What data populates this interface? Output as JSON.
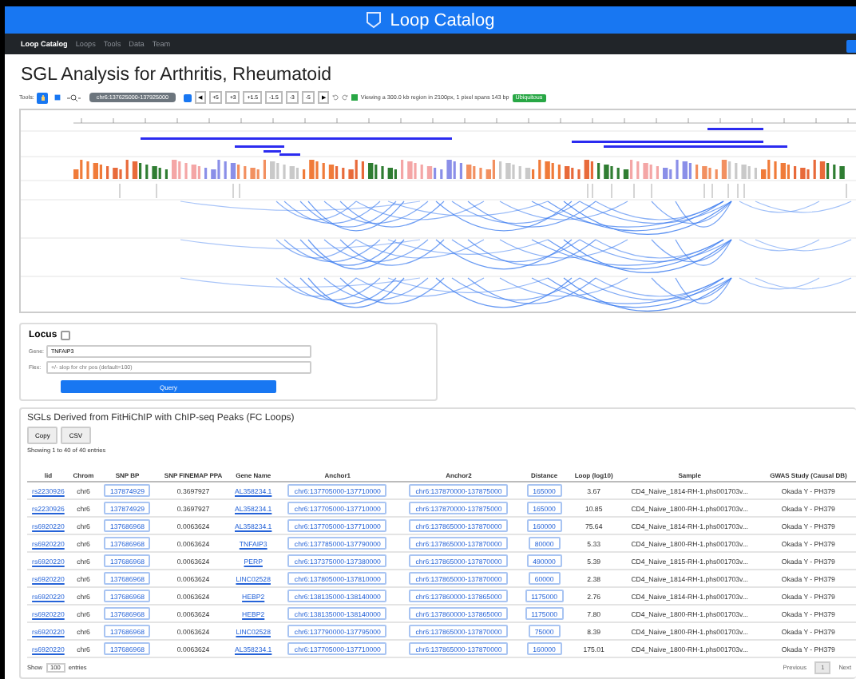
{
  "header": {
    "title": "Loop Catalog"
  },
  "nav": {
    "items": [
      {
        "label": "Loop Catalog",
        "selected": true
      },
      {
        "label": "Loops",
        "selected": false
      },
      {
        "label": "Tools",
        "selected": false
      },
      {
        "label": "Data",
        "selected": false
      },
      {
        "label": "Team",
        "selected": false
      }
    ]
  },
  "page_title": "SGL Analysis for Arthritis, Rheumatoid",
  "toolbar": {
    "label": "Tools:",
    "tools": [
      {
        "kind": "hand",
        "selected": true
      },
      {
        "kind": "select",
        "selected": false
      }
    ],
    "locus": "chr6:137625000-137925000",
    "nav_buttons": [
      "◀",
      "+5",
      "+3",
      "+1.5",
      "-1.5",
      "-3",
      "-5",
      "▶"
    ],
    "status": "Viewing a 300.0 kb region in 2100px, 1 pixel spans 143 bp",
    "badge": "Ubiquitous"
  },
  "locus_form": {
    "title": "Locus",
    "fields": [
      {
        "label": "Gene:",
        "value": "TNFAIP3"
      },
      {
        "label": "Flex:",
        "placeholder": "+/- slop for chr pos (default=100)"
      }
    ],
    "button": "Query"
  },
  "table_card": {
    "title": "SGLs Derived from FitHiChIP with ChIP-seq Peaks (FC Loops)",
    "buttons": [
      "Copy",
      "CSV"
    ],
    "info": "Showing 1 to 40 of 40 entries",
    "columns": [
      {
        "label": "lid",
        "kind": "link"
      },
      {
        "label": "Chrom",
        "kind": "text"
      },
      {
        "label": "SNP BP",
        "kind": "outline"
      },
      {
        "label": "SNP FINEMAP PPA",
        "kind": "text"
      },
      {
        "label": "Gene Name",
        "kind": "link"
      },
      {
        "label": "Anchor1",
        "kind": "outline"
      },
      {
        "label": "Anchor2",
        "kind": "outline"
      },
      {
        "label": "Distance",
        "kind": "outline"
      },
      {
        "label": "Loop (log10)",
        "kind": "text"
      },
      {
        "label": "Sample",
        "kind": "text"
      },
      {
        "label": "GWAS Study (Causal DB)",
        "kind": "text"
      }
    ],
    "rows": [
      [
        "rs2230926",
        "chr6",
        "137874929",
        "0.3697927",
        "AL358234.1",
        "chr6:137705000-137710000",
        "chr6:137870000-137875000",
        "165000",
        "3.67",
        "CD4_Naive_1814-RH-1.phs001703v...",
        "Okada Y - PH379"
      ],
      [
        "rs2230926",
        "chr6",
        "137874929",
        "0.3697927",
        "AL358234.1",
        "chr6:137705000-137710000",
        "chr6:137870000-137875000",
        "165000",
        "10.85",
        "CD4_Naive_1800-RH-1.phs001703v...",
        "Okada Y - PH379"
      ],
      [
        "rs6920220",
        "chr6",
        "137686968",
        "0.0063624",
        "AL358234.1",
        "chr6:137705000-137710000",
        "chr6:137865000-137870000",
        "160000",
        "75.64",
        "CD4_Naive_1814-RH-1.phs001703v...",
        "Okada Y - PH379"
      ],
      [
        "rs6920220",
        "chr6",
        "137686968",
        "0.0063624",
        "TNFAIP3",
        "chr6:137785000-137790000",
        "chr6:137865000-137870000",
        "80000",
        "5.33",
        "CD4_Naive_1800-RH-1.phs001703v...",
        "Okada Y - PH379"
      ],
      [
        "rs6920220",
        "chr6",
        "137686968",
        "0.0063624",
        "PERP",
        "chr6:137375000-137380000",
        "chr6:137865000-137870000",
        "490000",
        "5.39",
        "CD4_Naive_1815-RH-1.phs001703v...",
        "Okada Y - PH379"
      ],
      [
        "rs6920220",
        "chr6",
        "137686968",
        "0.0063624",
        "LINC02528",
        "chr6:137805000-137810000",
        "chr6:137865000-137870000",
        "60000",
        "2.38",
        "CD4_Naive_1814-RH-1.phs001703v...",
        "Okada Y - PH379"
      ],
      [
        "rs6920220",
        "chr6",
        "137686968",
        "0.0063624",
        "HEBP2",
        "chr6:138135000-138140000",
        "chr6:137860000-137865000",
        "1175000",
        "2.76",
        "CD4_Naive_1814-RH-1.phs001703v...",
        "Okada Y - PH379"
      ],
      [
        "rs6920220",
        "chr6",
        "137686968",
        "0.0063624",
        "HEBP2",
        "chr6:138135000-138140000",
        "chr6:137860000-137865000",
        "1175000",
        "7.80",
        "CD4_Naive_1800-RH-1.phs001703v...",
        "Okada Y - PH379"
      ],
      [
        "rs6920220",
        "chr6",
        "137686968",
        "0.0063624",
        "LINC02528",
        "chr6:137790000-137795000",
        "chr6:137865000-137870000",
        "75000",
        "8.39",
        "CD4_Naive_1800-RH-1.phs001703v...",
        "Okada Y - PH379"
      ],
      [
        "rs6920220",
        "chr6",
        "137686968",
        "0.0063624",
        "AL358234.1",
        "chr6:137705000-137710000",
        "chr6:137865000-137870000",
        "160000",
        "175.01",
        "CD4_Naive_1800-RH-1.phs001703v...",
        "Okada Y - PH379"
      ]
    ],
    "footer": {
      "show": "Show",
      "length": "100",
      "entries": "entries",
      "pages": [
        {
          "label": "Previous",
          "selected": false
        },
        {
          "label": "1",
          "selected": true
        },
        {
          "label": "Next",
          "selected": false
        }
      ]
    }
  }
}
